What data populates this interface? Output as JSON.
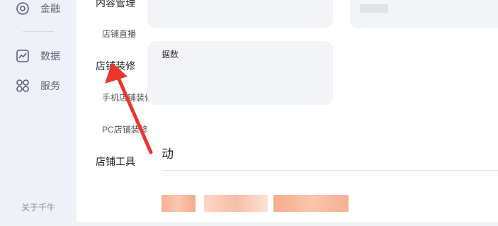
{
  "nav": {
    "items": [
      {
        "label": "金融",
        "icon": "finance-icon"
      },
      {
        "label": "数据",
        "icon": "chart-icon"
      },
      {
        "label": "服务",
        "icon": "apps-icon"
      }
    ],
    "footer": "关于千牛"
  },
  "submenu": {
    "sections": [
      {
        "label": "内容管理",
        "expanded": true
      },
      {
        "label": "店铺装修",
        "expanded": true
      },
      {
        "label": "店铺工具",
        "expanded": false
      }
    ],
    "sub_items": [
      "店铺直播",
      "手机店铺装修",
      "PC店铺装修"
    ]
  },
  "main": {
    "card_label_partial": "据数",
    "section_title_partial": "动"
  },
  "colors": {
    "accent_arrow": "#e8382c",
    "nav_bg": "#eef1f8",
    "card_bg": "#f3f4f8"
  }
}
